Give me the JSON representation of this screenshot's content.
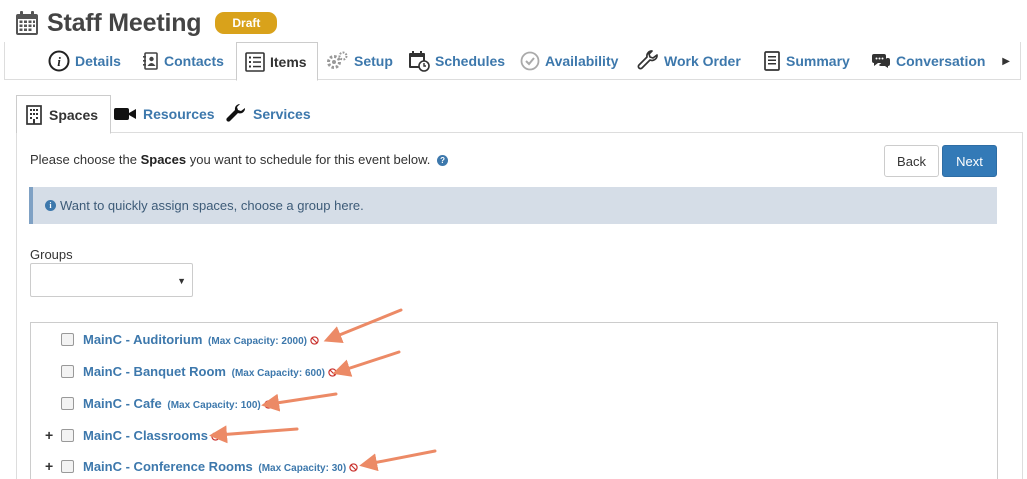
{
  "header": {
    "title": "Staff Meeting",
    "status": "Draft"
  },
  "main_tabs": [
    {
      "label": "Details",
      "icon": "info-icon"
    },
    {
      "label": "Contacts",
      "icon": "address-book-icon"
    },
    {
      "label": "Items",
      "icon": "list-icon",
      "active": true
    },
    {
      "label": "Setup",
      "icon": "gears-icon"
    },
    {
      "label": "Schedules",
      "icon": "calendar-clock-icon"
    },
    {
      "label": "Availability",
      "icon": "check-circle-icon"
    },
    {
      "label": "Work Order",
      "icon": "wrench-icon"
    },
    {
      "label": "Summary",
      "icon": "document-icon"
    },
    {
      "label": "Conversation",
      "icon": "chat-icon"
    }
  ],
  "sub_tabs": [
    {
      "label": "Spaces",
      "icon": "building-icon",
      "active": true
    },
    {
      "label": "Resources",
      "icon": "video-camera-icon"
    },
    {
      "label": "Services",
      "icon": "wrench-icon"
    }
  ],
  "content": {
    "instruction_pre": "Please choose the ",
    "instruction_bold": "Spaces",
    "instruction_post": " you want to schedule for this event below.",
    "back_label": "Back",
    "next_label": "Next",
    "info_text": "Want to quickly assign spaces, choose a group here.",
    "groups_label": "Groups",
    "groups_selected": ""
  },
  "spaces": [
    {
      "name": "MainC - Auditorium",
      "capacity": "(Max Capacity: 2000)",
      "expandable": false
    },
    {
      "name": "MainC - Banquet Room",
      "capacity": "(Max Capacity: 600)",
      "expandable": false
    },
    {
      "name": "MainC - Cafe",
      "capacity": "(Max Capacity: 100)",
      "expandable": false
    },
    {
      "name": "MainC - Classrooms",
      "capacity": "",
      "expandable": true
    },
    {
      "name": "MainC - Conference Rooms",
      "capacity": "(Max Capacity: 30)",
      "expandable": true
    }
  ],
  "colors": {
    "link": "#3d78ac",
    "badge": "#d9a21b",
    "primary_button": "#337ab7",
    "ban": "#c9302c",
    "annotation_arrow": "#ec8a66"
  }
}
